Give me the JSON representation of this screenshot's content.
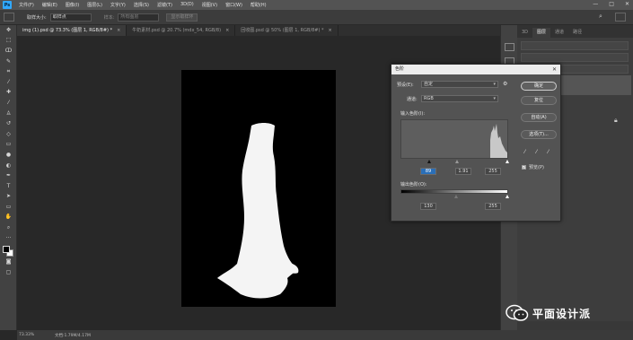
{
  "app": {
    "logo": "Ps"
  },
  "menu": [
    "文件(F)",
    "编辑(E)",
    "图像(I)",
    "图层(L)",
    "文字(Y)",
    "选择(S)",
    "滤镜(T)",
    "3D(D)",
    "视图(V)",
    "窗口(W)",
    "帮助(H)"
  ],
  "window_controls": [
    "—",
    "□",
    "✕"
  ],
  "options_bar": {
    "sample_size_label": "取样大小:",
    "sample_size_value": "取样点",
    "sample_label": "样本:",
    "sample_value": "所有图层",
    "show_ring_label": "显示取样环"
  },
  "tabs": [
    {
      "label": "img (1).psd @ 73.3% (图层 1, RGB/8#) *",
      "active": true
    },
    {
      "label": "牛奶素材.psd @ 20.7% (mdx_54, RGB/8)",
      "active": false
    },
    {
      "label": "回收图.psd @ 50% (图层 1, RGB/8#) *",
      "active": false
    }
  ],
  "status": {
    "zoom": "73.33%",
    "doc": "文档:1.79M/4.17M"
  },
  "right_panel": {
    "top_tabs": [
      "3D",
      "图层",
      "通道",
      "路径"
    ],
    "active_tab": "图层"
  },
  "levels_dialog": {
    "title": "色阶",
    "preset_label": "预设(E):",
    "preset_value": "自定",
    "channel_label": "通道:",
    "channel_value": "RGB",
    "input_label": "输入色阶(I):",
    "output_label": "输出色阶(O):",
    "input_black": "89",
    "input_gamma": "1.91",
    "input_white": "255",
    "output_black": "130",
    "output_white": "255",
    "ok": "确定",
    "reset": "复位",
    "auto": "自动(A)",
    "options": "选项(T)...",
    "preview": "预览(P)",
    "preview_checked": true
  },
  "watermark": {
    "text": "平面设计派"
  },
  "colors": {
    "accent": "#31a8ff",
    "selected_input": "#2a6fb8"
  }
}
